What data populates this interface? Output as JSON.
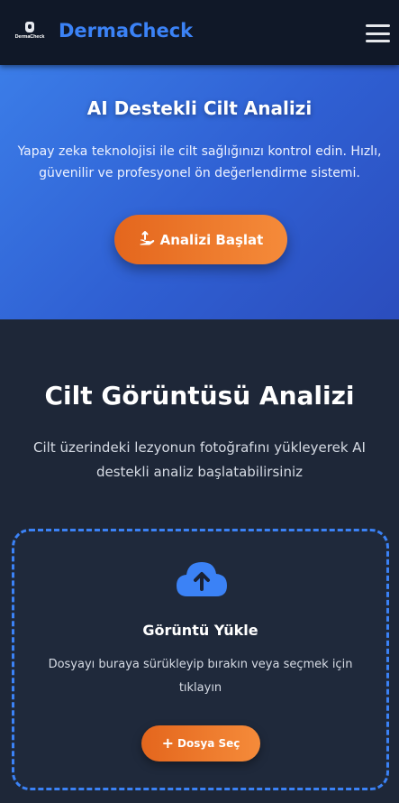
{
  "header": {
    "logo_text": "DermaCheck",
    "brand": "DermaCheck",
    "menu_icon": "hamburger-menu-icon"
  },
  "hero": {
    "title": "AI Destekli Cilt Analizi",
    "description": "Yapay zeka teknolojisi ile cilt sağlığınızı kontrol edin. Hızlı, güvenilir ve profesyonel ön değerlendirme sistemi.",
    "button_label": "Analizi Başlat",
    "button_icon": "hand-upload-icon"
  },
  "analysis": {
    "title": "Cilt Görüntüsü Analizi",
    "description": "Cilt üzerindeki lezyonun fotoğrafını yükleyerek AI destekli analiz başlatabilirsiniz"
  },
  "upload": {
    "icon": "cloud-upload-icon",
    "title": "Görüntü Yükle",
    "description": "Dosyayı buraya sürükleyip bırakın veya seçmek için tıklayın",
    "button_label": "Dosya Seç",
    "button_icon": "plus-icon"
  },
  "colors": {
    "accent_blue": "#3b82f6",
    "accent_orange": "#f07a2a",
    "header_bg": "#101828",
    "page_bg": "#1e2738"
  }
}
